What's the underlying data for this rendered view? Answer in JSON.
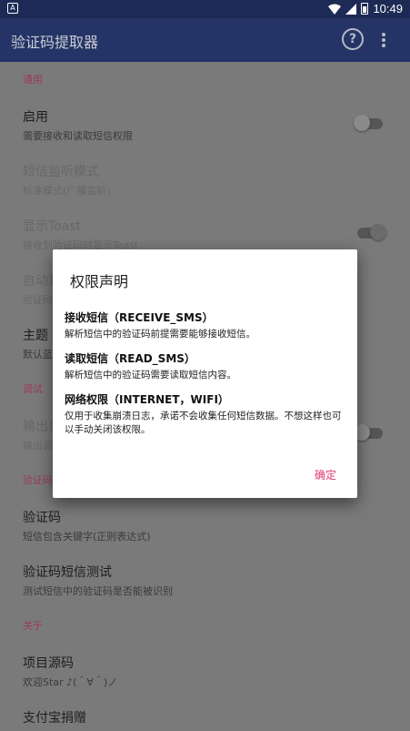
{
  "status": {
    "notification_glyph": "A",
    "time": "10:49",
    "icons": [
      "wifi-icon",
      "signal-icon",
      "battery-icon"
    ]
  },
  "appbar": {
    "title": "验证码提取器",
    "help_glyph": "?"
  },
  "sections": [
    {
      "header": "通用",
      "prefs": [
        {
          "title": "启用",
          "summary": "需要接收和读取短信权限",
          "switch": "off",
          "disabled": false
        },
        {
          "title": "短信监听模式",
          "summary": "标准模式(广播监听)",
          "switch": null,
          "disabled": true
        },
        {
          "title": "显示Toast",
          "summary": "接收到验证码时显示Toast",
          "switch": "on",
          "disabled": true
        },
        {
          "title": "自动复",
          "summary": "验证码",
          "switch": null,
          "disabled": true
        },
        {
          "title": "主题",
          "summary": "默认蓝",
          "switch": null,
          "disabled": false
        }
      ]
    },
    {
      "header": "调试",
      "prefs": [
        {
          "title": "输出日",
          "summary": "输出调",
          "switch": "off",
          "disabled": true
        }
      ]
    },
    {
      "header": "验证码",
      "prefs": [
        {
          "title": "验证码",
          "summary": "短信包含关键字(正则表达式)",
          "switch": null,
          "disabled": false
        },
        {
          "title": "验证码短信测试",
          "summary": "测试短信中的验证码是否能被识别",
          "switch": null,
          "disabled": false
        }
      ]
    },
    {
      "header": "关于",
      "prefs": [
        {
          "title": "项目源码",
          "summary": "欢迎Star ♪(＾∀＾)ノ",
          "switch": null,
          "disabled": false
        },
        {
          "title": "支付宝捐赠",
          "summary": "",
          "switch": null,
          "disabled": false
        }
      ]
    }
  ],
  "dialog": {
    "title": "权限声明",
    "permissions": [
      {
        "name": "接收短信（RECEIVE_SMS）",
        "desc": "解析短信中的验证码前提需要能够接收短信。"
      },
      {
        "name": "读取短信（READ_SMS）",
        "desc": "解析短信中的验证码需要读取短信内容。"
      },
      {
        "name": "网络权限（INTERNET，WIFI）",
        "desc": "仅用于收集崩溃日志，承诺不会收集任何短信数据。不想这样也可以手动关闭该权限。"
      }
    ],
    "ok_label": "确定"
  }
}
